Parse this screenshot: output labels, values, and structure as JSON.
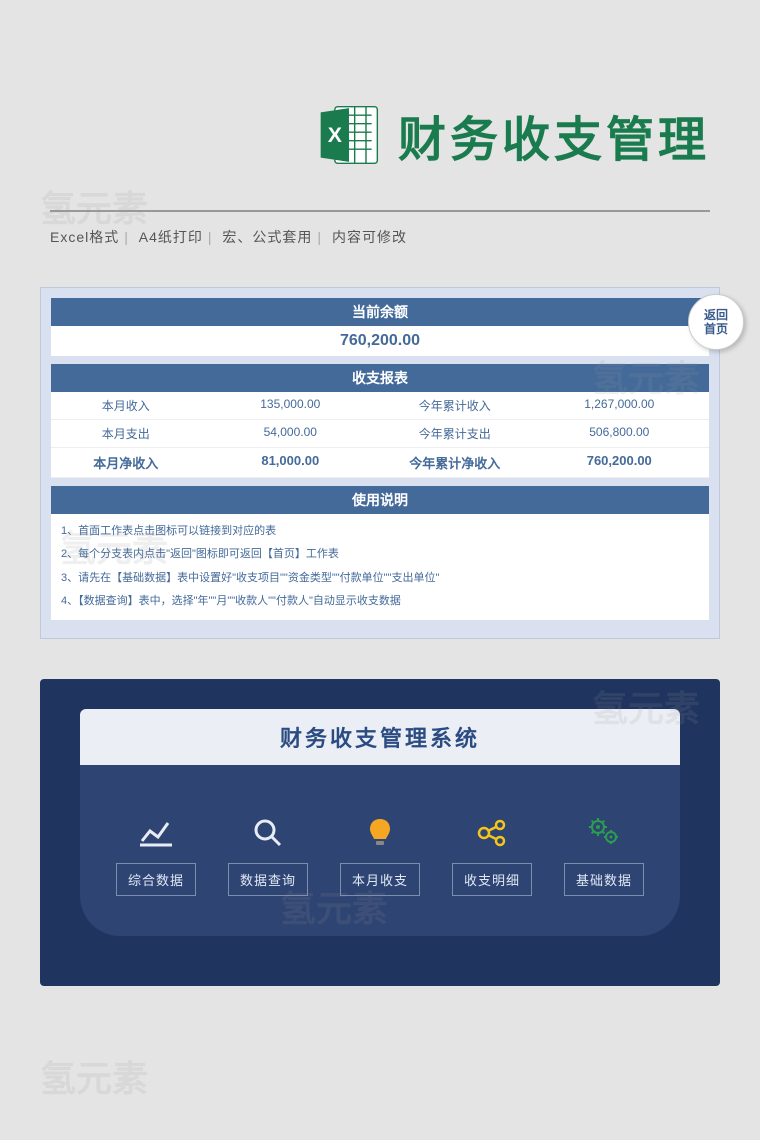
{
  "watermark": "氢元素",
  "header": {
    "title": "财务收支管理",
    "features": [
      "Excel格式",
      "A4纸打印",
      "宏、公式套用",
      "内容可修改"
    ]
  },
  "card1": {
    "home_button": "返回\n首页",
    "balance": {
      "title": "当前余额",
      "value": "760,200.00"
    },
    "report": {
      "title": "收支报表",
      "rows": [
        {
          "l1": "本月收入",
          "v1": "135,000.00",
          "l2": "今年累计收入",
          "v2": "1,267,000.00"
        },
        {
          "l1": "本月支出",
          "v1": "54,000.00",
          "l2": "今年累计支出",
          "v2": "506,800.00"
        },
        {
          "l1": "本月净收入",
          "v1": "81,000.00",
          "l2": "今年累计净收入",
          "v2": "760,200.00",
          "bold": true
        }
      ]
    },
    "instructions": {
      "title": "使用说明",
      "items": [
        "1、首面工作表点击图标可以链接到对应的表",
        "2、每个分支表内点击\"返回\"图标即可返回【首页】工作表",
        "3、请先在【基础数据】表中设置好\"收支项目\"\"资金类型\"\"付款单位\"\"支出单位\"",
        "4、【数据查询】表中，选择\"年\"\"月\"\"收款人\"\"付款人\"自动显示收支数据"
      ]
    }
  },
  "card2": {
    "title": "财务收支管理系统",
    "nav": [
      {
        "icon": "chart",
        "label": "综合数据"
      },
      {
        "icon": "search",
        "label": "数据查询"
      },
      {
        "icon": "bulb",
        "label": "本月收支"
      },
      {
        "icon": "connect",
        "label": "收支明细"
      },
      {
        "icon": "gear",
        "label": "基础数据"
      }
    ]
  }
}
